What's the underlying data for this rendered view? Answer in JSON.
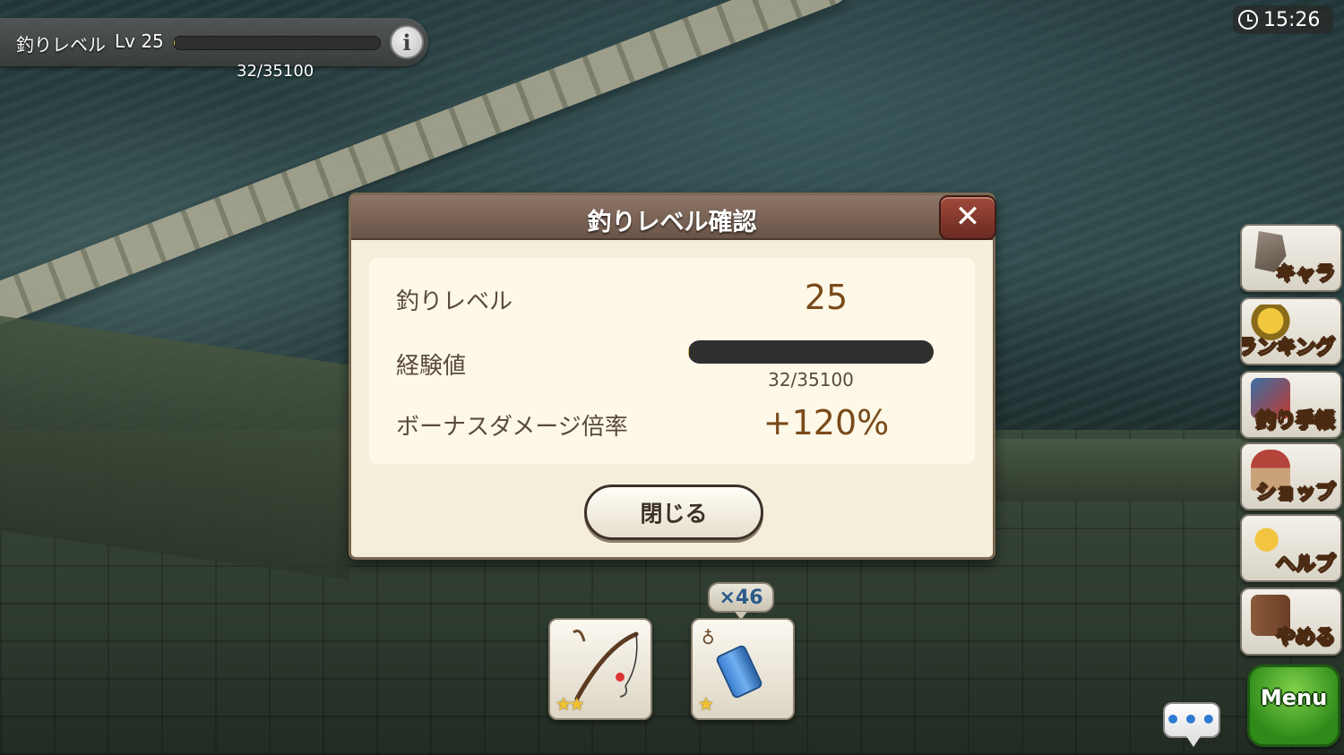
{
  "hud": {
    "level_label": "釣りレベル",
    "level_lv": "Lv 25",
    "level_progress": "32/35100",
    "level_fraction": 0.0009,
    "info_label": "i",
    "clock": "15:26"
  },
  "dialog": {
    "title": "釣りレベル確認",
    "close_x": "✕",
    "rows": {
      "level_label": "釣りレベル",
      "level_value": "25",
      "exp_label": "経験値",
      "exp_value": "32/35100",
      "exp_fraction": 0.0009,
      "bonus_label": "ボーナスダメージ倍率",
      "bonus_value": "+120%"
    },
    "close_button": "閉じる"
  },
  "side_menu": [
    {
      "label": "キャラ",
      "icon": "character-icon"
    },
    {
      "label": "ランキング",
      "icon": "trophy-icon"
    },
    {
      "label": "釣り手帳",
      "icon": "notebook-icon"
    },
    {
      "label": "ショップ",
      "icon": "shop-icon"
    },
    {
      "label": "ヘルプ",
      "icon": "help-icon"
    },
    {
      "label": "やめる",
      "icon": "quit-icon"
    }
  ],
  "menu_button": "Menu",
  "chat_button": "•••",
  "items": {
    "rod_stars": "★★",
    "bait_stars": "★",
    "bait_count": "×46"
  }
}
